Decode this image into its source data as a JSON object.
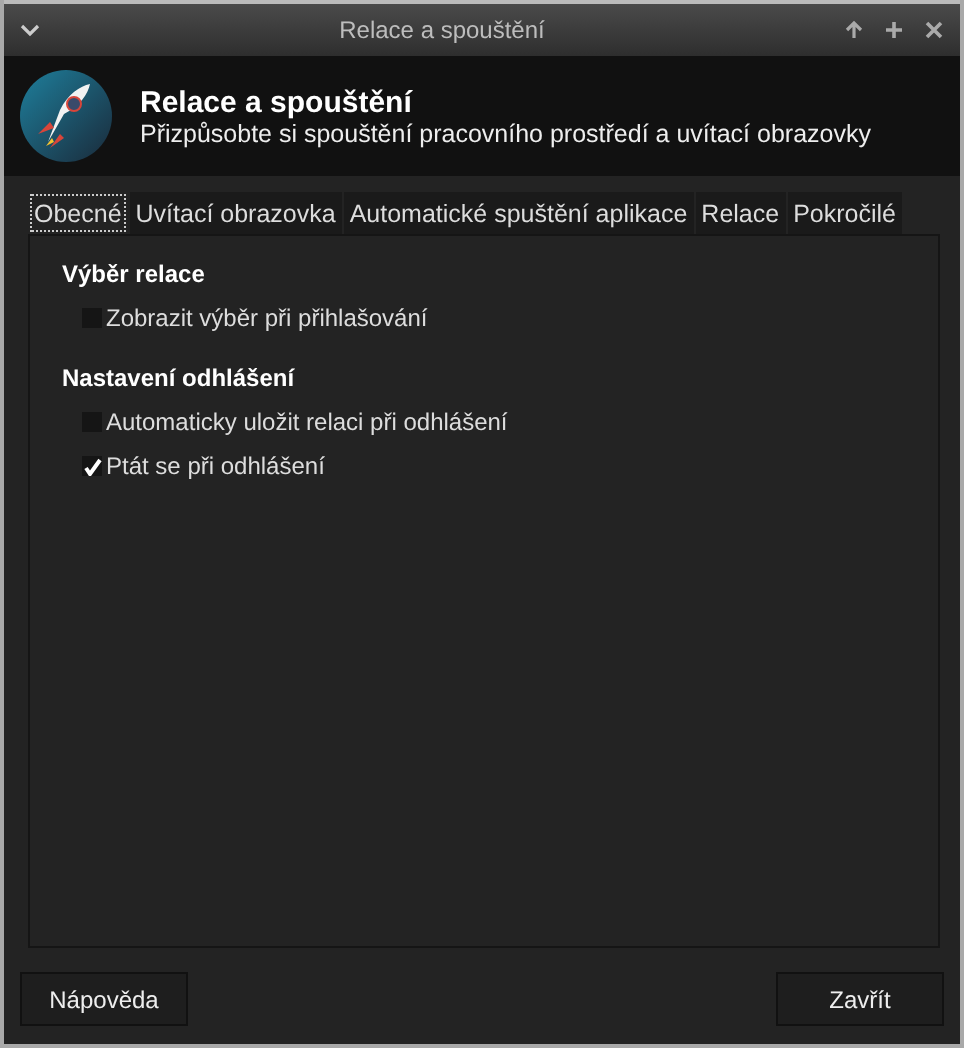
{
  "window": {
    "title": "Relace a spouštění"
  },
  "header": {
    "title": "Relace a spouštění",
    "subtitle": "Přizpůsobte si spouštění pracovního prostředí a uvítací obrazovky"
  },
  "tabs": [
    {
      "label": "Obecné",
      "selected": true
    },
    {
      "label": "Uvítací obrazovka",
      "selected": false
    },
    {
      "label": "Automatické spuštění aplikace",
      "selected": false
    },
    {
      "label": "Relace",
      "selected": false
    },
    {
      "label": "Pokročilé",
      "selected": false
    }
  ],
  "sections": [
    {
      "title": "Výběr relace",
      "options": [
        {
          "label": "Zobrazit výběr při přihlašování",
          "checked": false
        }
      ]
    },
    {
      "title": "Nastavení odhlášení",
      "options": [
        {
          "label": "Automaticky uložit relaci při odhlášení",
          "checked": false
        },
        {
          "label": "Ptát se při odhlášení",
          "checked": true
        }
      ]
    }
  ],
  "buttons": {
    "help": "Nápověda",
    "close": "Zavřít"
  }
}
